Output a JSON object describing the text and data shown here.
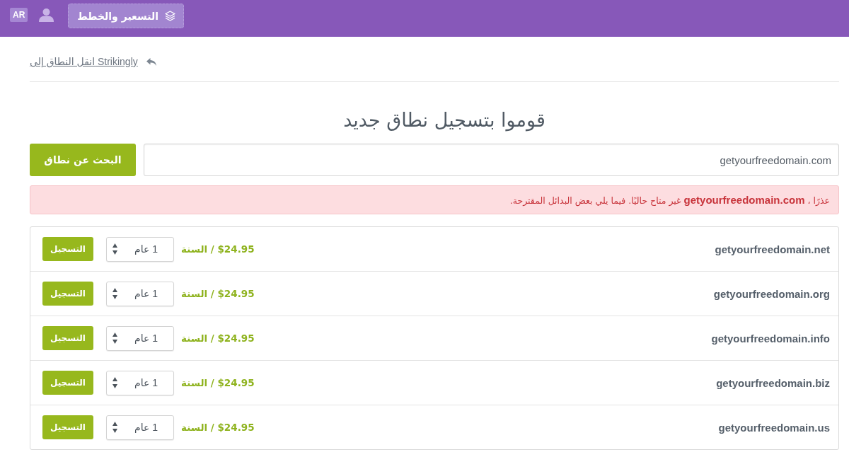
{
  "top_bar": {
    "language_badge": "AR",
    "pricing_button": "التسعير والخطط"
  },
  "back_link": "انقل النطاق إلى Strikingly",
  "heading": "قوموا بتسجيل نطاق جديد",
  "search": {
    "value": "getyourfreedomain.com",
    "button": "البحث عن نطاق"
  },
  "alert": "عذرًا ، **getyourfreedomain.com** غير متاح حاليًا. فيما يلي بعض البدائل المقترحة.",
  "results": [
    {
      "domain": "getyourfreedomain.net",
      "price": "$24.95 / السنة",
      "term": "1 عام",
      "button": "التسجيل"
    },
    {
      "domain": "getyourfreedomain.org",
      "price": "$24.95 / السنة",
      "term": "1 عام",
      "button": "التسجيل"
    },
    {
      "domain": "getyourfreedomain.info",
      "price": "$24.95 / السنة",
      "term": "1 عام",
      "button": "التسجيل"
    },
    {
      "domain": "getyourfreedomain.biz",
      "price": "$24.95 / السنة",
      "term": "1 عام",
      "button": "التسجيل"
    },
    {
      "domain": "getyourfreedomain.us",
      "price": "$24.95 / السنة",
      "term": "1 عام",
      "button": "التسجيل"
    }
  ]
}
